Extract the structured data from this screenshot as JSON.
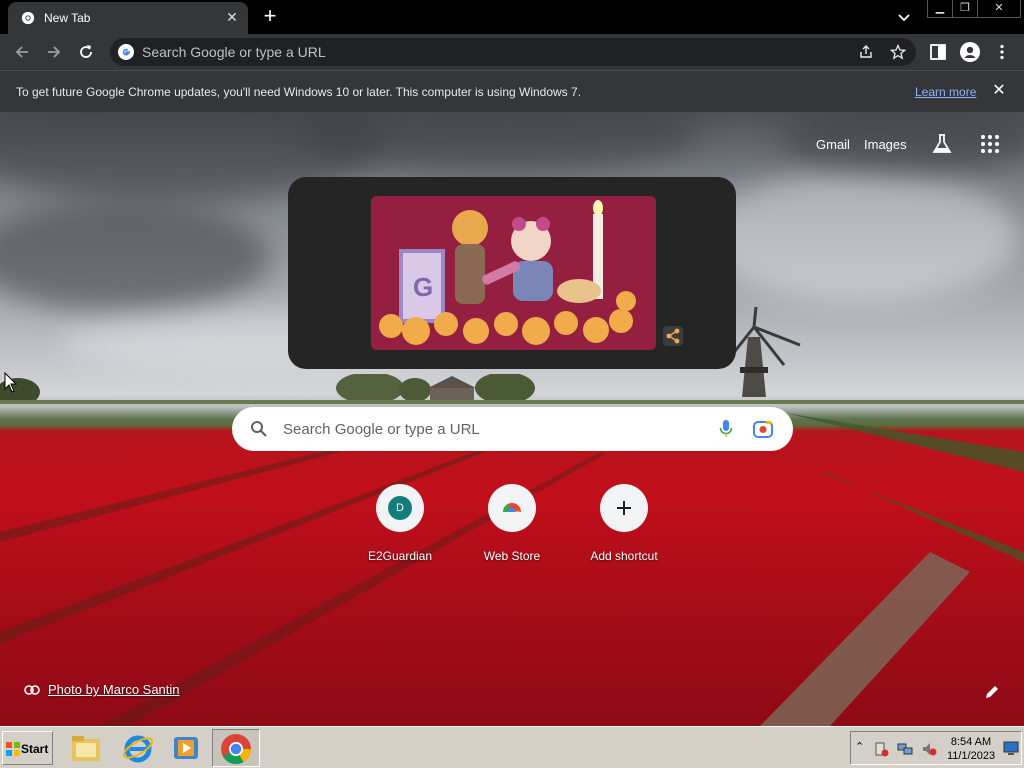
{
  "browser": {
    "tab_title": "New Tab",
    "omnibox_placeholder": "Search Google or type a URL"
  },
  "infobar": {
    "message": "To get future Google Chrome updates, you'll need Windows 10 or later. This computer is using Windows 7.",
    "learn_more": "Learn more"
  },
  "ntp": {
    "links": {
      "gmail": "Gmail",
      "images": "Images"
    },
    "search_placeholder": "Search Google or type a URL",
    "shortcuts": [
      {
        "label": "E2Guardian",
        "initial": "D"
      },
      {
        "label": "Web Store"
      },
      {
        "label": "Add shortcut"
      }
    ],
    "attribution": "Photo by Marco Santin"
  },
  "taskbar": {
    "start_label": "Start",
    "time": "8:54 AM",
    "date": "11/1/2023"
  },
  "colors": {
    "tab_bg": "#35363a",
    "omnibox_bg": "#202124",
    "link": "#8ab4f8",
    "tile_bg": "#f1f3f4",
    "avatar_teal": "#137d7b"
  }
}
